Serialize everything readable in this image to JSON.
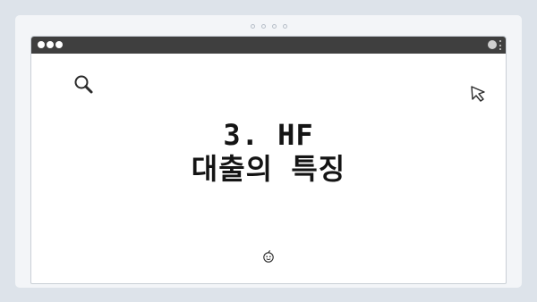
{
  "browser": {
    "window_controls": [
      "close",
      "minimize",
      "maximize"
    ],
    "toolbar_icons": [
      "profile-icon",
      "menu-kebab-icon"
    ]
  },
  "content": {
    "title_line1": "3. HF",
    "title_line2": "대출의 특징"
  },
  "icons": [
    "search-icon",
    "cursor-arrow-icon",
    "smile-icon"
  ],
  "colors": {
    "background": "#dde3ea",
    "card": "#f3f5f8",
    "titlebar": "#3f3f3f",
    "text": "#141414"
  }
}
